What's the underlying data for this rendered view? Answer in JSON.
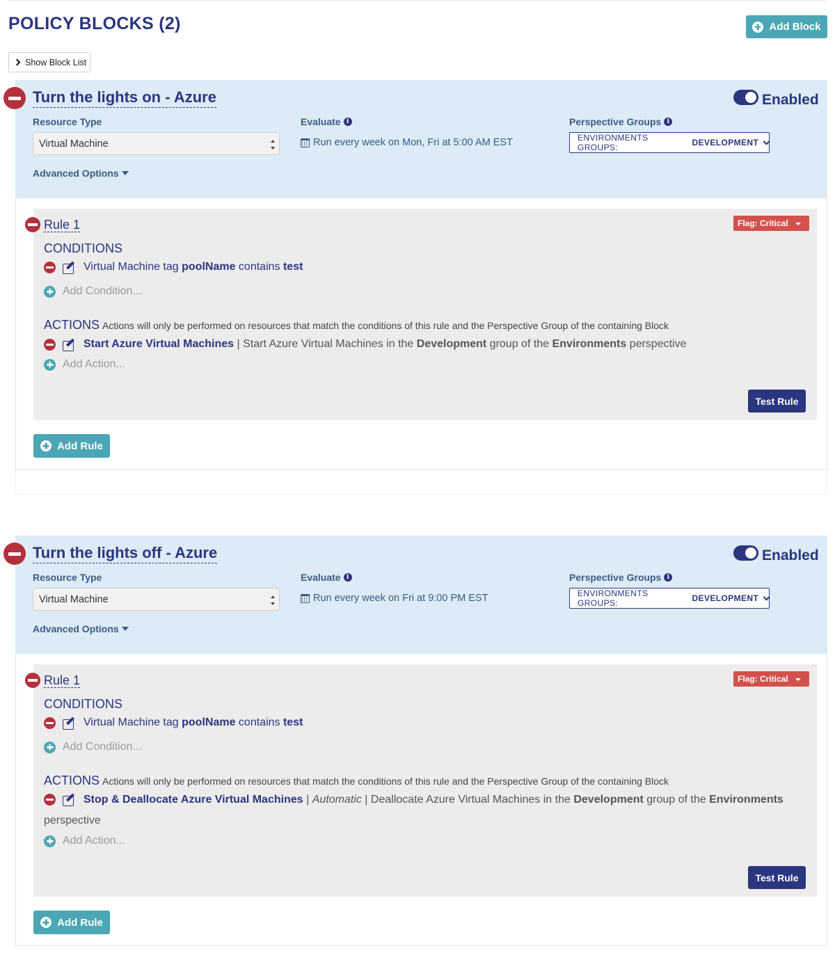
{
  "page": {
    "title": "POLICY BLOCKS (2)",
    "add_block_label": "Add Block",
    "show_block_list_label": "Show Block List"
  },
  "labels": {
    "resource_type": "Resource Type",
    "evaluate": "Evaluate",
    "perspective_groups": "Perspective Groups",
    "advanced_options": "Advanced Options",
    "enabled": "Enabled",
    "conditions": "CONDITIONS",
    "actions": "ACTIONS",
    "actions_note": "Actions will only be performed on resources that match the conditions of this rule and the Perspective Group of the containing Block",
    "add_condition": "Add Condition...",
    "add_action": "Add Action...",
    "test_rule": "Test Rule",
    "add_rule": "Add Rule",
    "info_glyph": "i"
  },
  "blocks": [
    {
      "title": "Turn the lights on - Azure",
      "enabled": true,
      "resource_type": "Virtual Machine",
      "schedule": "Run every week on Mon, Fri at 5:00 AM EST",
      "perspective_prefix": "ENVIRONMENTS GROUPS:",
      "perspective_value": "DEVELOPMENT",
      "rule": {
        "title": "Rule 1",
        "flag": "Flag: Critical",
        "condition": {
          "pre": "Virtual Machine tag",
          "tag": "poolName",
          "mid": "contains",
          "value": "test"
        },
        "action": {
          "name": "Start Azure Virtual Machines",
          "sep1": "|",
          "mode": "",
          "sep2": "",
          "desc_pre": "Start Azure Virtual Machines in the",
          "group": "Development",
          "desc_mid": "group of the",
          "perspective": "Environments",
          "desc_post": "perspective"
        }
      }
    },
    {
      "title": "Turn the lights off - Azure",
      "enabled": true,
      "resource_type": "Virtual Machine",
      "schedule": "Run every week on Fri at 9:00 PM EST",
      "perspective_prefix": "ENVIRONMENTS GROUPS:",
      "perspective_value": "DEVELOPMENT",
      "rule": {
        "title": "Rule 1",
        "flag": "Flag: Critical",
        "condition": {
          "pre": "Virtual Machine tag",
          "tag": "poolName",
          "mid": "contains",
          "value": "test"
        },
        "action": {
          "name": "Stop & Deallocate Azure Virtual Machines",
          "sep1": "|",
          "mode": "Automatic",
          "sep2": "|",
          "desc_pre": "Deallocate Azure Virtual Machines in the",
          "group": "Development",
          "desc_mid": "group of the",
          "perspective": "Environments",
          "desc_post": "perspective"
        }
      }
    }
  ],
  "colors": {
    "primary_navy": "#2b3580",
    "teal": "#4ba6b5",
    "danger_red": "#b5303d",
    "flag_red": "#d2524b",
    "header_blue": "#dcebf5",
    "rule_gray": "#ececec"
  },
  "icons": [
    "plus-circle-icon",
    "chevron-right-icon",
    "minus-circle-icon",
    "toggle-icon",
    "info-icon",
    "calendar-icon",
    "chevron-down-icon",
    "caret-down-icon",
    "edit-icon"
  ]
}
